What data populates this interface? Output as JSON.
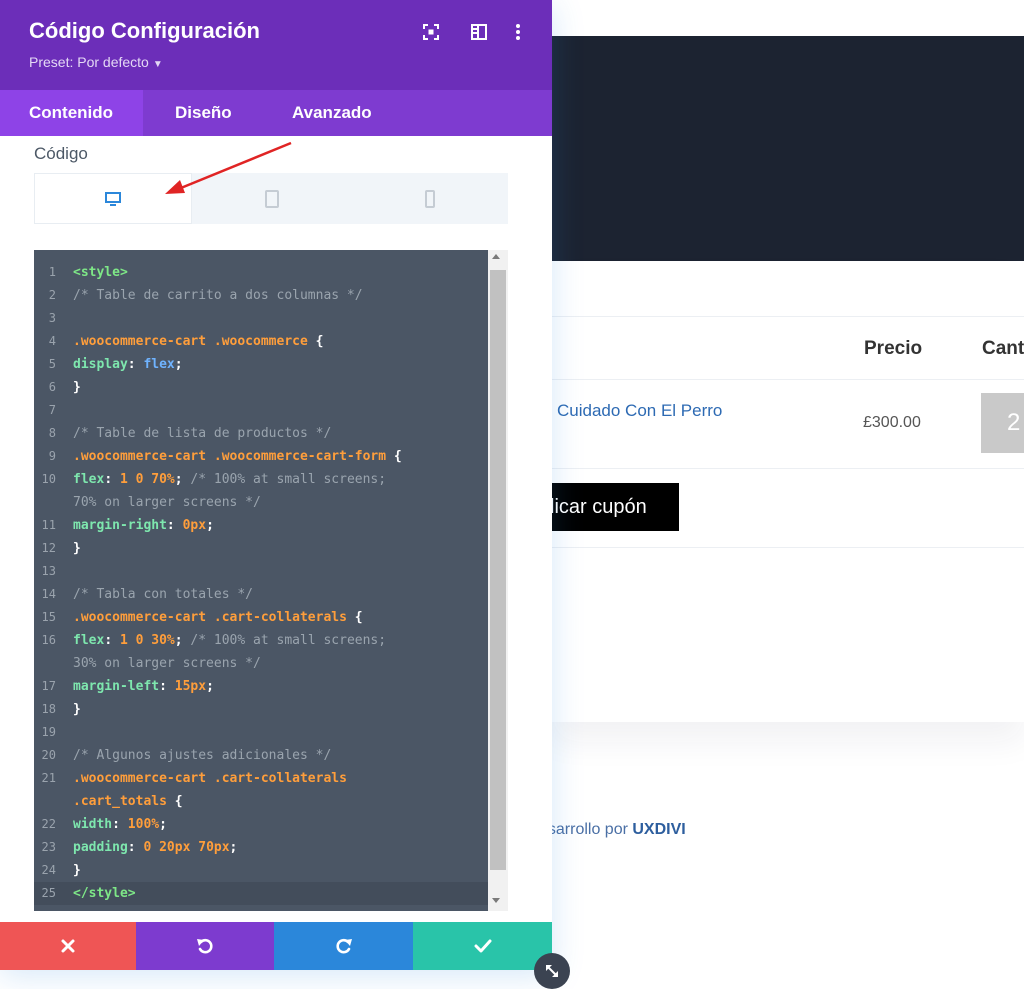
{
  "modal": {
    "title": "Código Configuración",
    "preset_label": "Preset: Por defecto",
    "header_icons": [
      "focus-icon",
      "split-view-icon",
      "more-vertical-icon"
    ],
    "tabs": [
      {
        "label": "Contenido",
        "active": true
      },
      {
        "label": "Diseño",
        "active": false
      },
      {
        "label": "Avanzado",
        "active": false
      }
    ],
    "field_label": "Código",
    "device_tabs": [
      {
        "icon": "desktop-icon",
        "active": true
      },
      {
        "icon": "tablet-icon",
        "active": false
      },
      {
        "icon": "phone-icon",
        "active": false
      }
    ],
    "code": [
      "<style>",
      "/* Table de carrito a dos columnas */",
      "",
      ".woocommerce-cart .woocommerce {",
      "  display: flex;",
      "}",
      "",
      "/* Table de lista de productos */",
      ".woocommerce-cart .woocommerce-cart-form {",
      "  flex: 1 0 70%; /* 100% at small screens;",
      "70% on larger screens */",
      "  margin-right: 0px;",
      "}",
      "",
      "/* Tabla con totales */",
      ".woocommerce-cart .cart-collaterals {",
      "  flex: 1 0 30%; /* 100% at small screens;",
      "30% on larger screens */",
      "  margin-left: 15px;",
      "}",
      "",
      "/* Algunos ajustes adicionales */",
      ".woocommerce-cart .cart-collaterals",
      ".cart_totals {",
      "  width: 100%;",
      "  padding: 0 20px 70px;",
      "}",
      "</style>"
    ],
    "line_numbers": [
      "1",
      "2",
      "3",
      "4",
      "5",
      "6",
      "7",
      "8",
      "9",
      "10",
      "",
      "11",
      "12",
      "13",
      "14",
      "15",
      "16",
      "",
      "17",
      "18",
      "19",
      "20",
      "21",
      "",
      "22",
      "23",
      "24",
      "25"
    ],
    "footer_buttons": [
      {
        "name": "discard-button",
        "icon": "close-icon",
        "color": "#ef5555"
      },
      {
        "name": "undo-button",
        "icon": "undo-icon",
        "color": "#7d3bcf"
      },
      {
        "name": "redo-button",
        "icon": "redo-icon",
        "color": "#2b87da"
      },
      {
        "name": "save-button",
        "icon": "check-icon",
        "color": "#29c4a9"
      }
    ]
  },
  "page": {
    "col_precio": "Precio",
    "col_cantidad": "Cant",
    "product_name": "Cuidado Con El Perro",
    "product_price": "£300.00",
    "quantity": "2",
    "coupon_button": "licar cupón",
    "footer_prefix": "esarrollo por ",
    "footer_brand": "UXDIVI"
  },
  "colors": {
    "header_purple": "#6c2eb9",
    "tabs_purple": "#7e3bd0",
    "editor_bg": "#4b5665",
    "hero_dark": "#1c2331",
    "link_blue": "#2d6ab3"
  }
}
